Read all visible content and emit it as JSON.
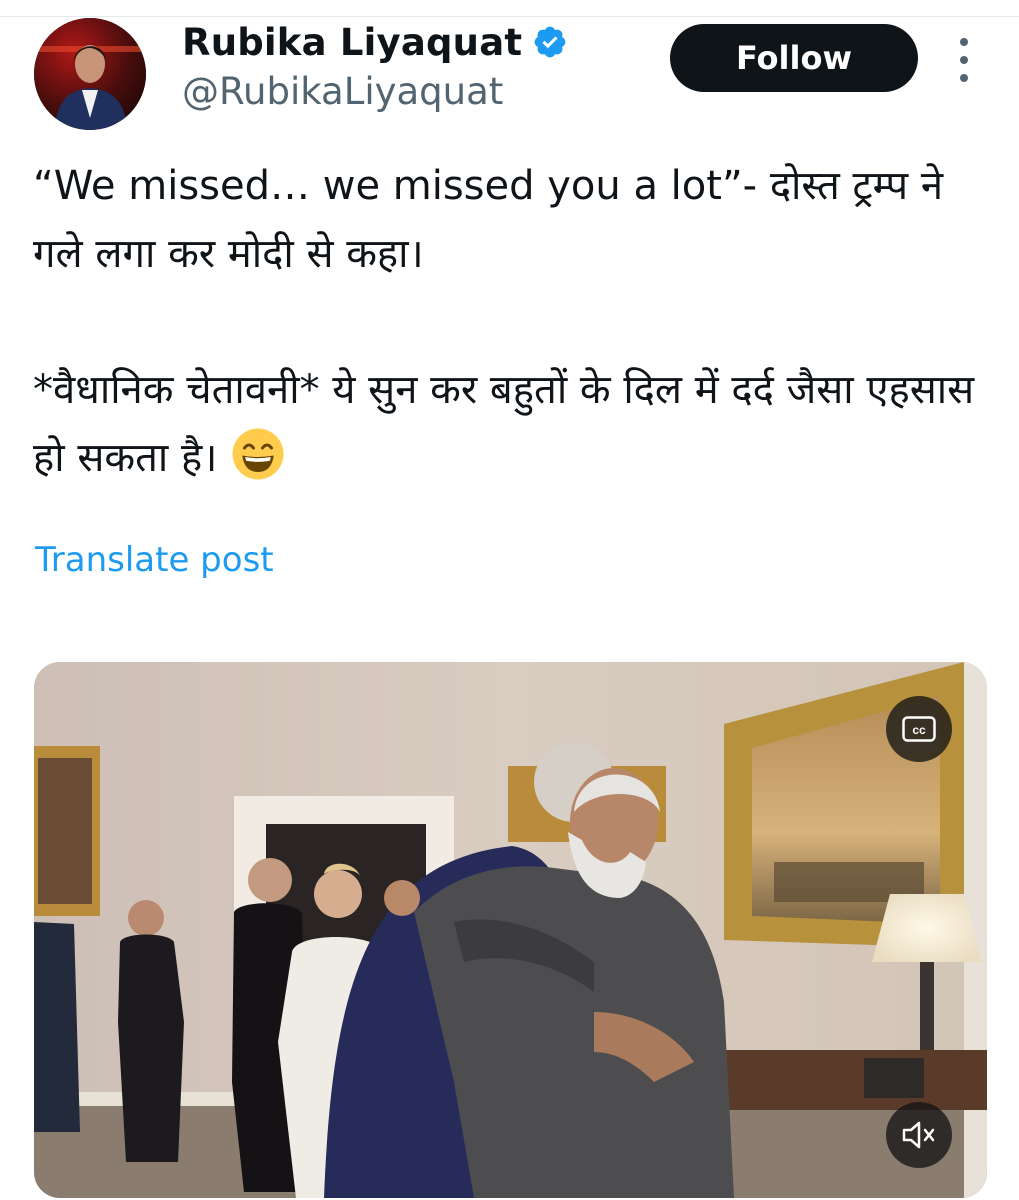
{
  "author": {
    "display_name": "Rubika Liyaquat",
    "handle": "@RubikaLiyaquat",
    "verified": true,
    "avatar_icon": "profile-photo"
  },
  "follow_button": {
    "label": "Follow"
  },
  "more_menu": {
    "icon": "more-vertical-icon"
  },
  "post": {
    "text": "“We missed… we missed you a lot”-  दोस्त ट्रम्प ने गले लगा कर मोदी से कहा।\n\n*वैधानिक चेतावनी* ये सुन कर बहुतों के दिल में दर्द जैसा एहसास  हो सकता है।",
    "emoji": "grinning-face-with-smiling-eyes"
  },
  "translate_link": {
    "label": "Translate post"
  },
  "media": {
    "type": "video",
    "cc_button": {
      "icon": "closed-captions-icon",
      "label": "cc"
    },
    "mute_button": {
      "icon": "speaker-muted-icon"
    }
  },
  "colors": {
    "link": "#1d9bf0",
    "verified": "#1d9bf0",
    "follow_bg": "#0f1419",
    "secondary_text": "#536471"
  }
}
